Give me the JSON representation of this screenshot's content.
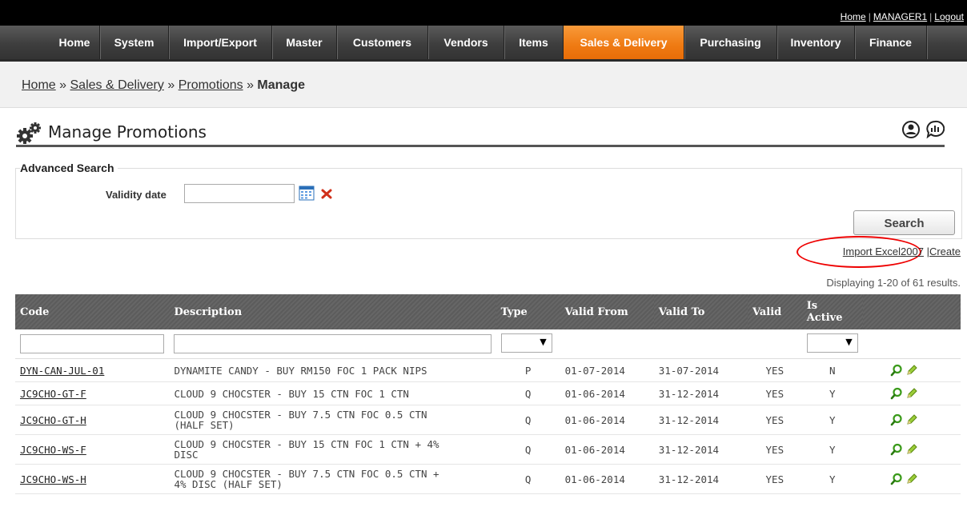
{
  "top_links": {
    "home": "Home",
    "user": "MANAGER1",
    "logout": "Logout"
  },
  "nav": [
    {
      "label": "Home"
    },
    {
      "label": "System"
    },
    {
      "label": "Import/Export"
    },
    {
      "label": "Master"
    },
    {
      "label": "Customers"
    },
    {
      "label": "Vendors"
    },
    {
      "label": "Items"
    },
    {
      "label": "Sales & Delivery",
      "active": true
    },
    {
      "label": "Purchasing"
    },
    {
      "label": "Inventory"
    },
    {
      "label": "Finance"
    }
  ],
  "breadcrumb": {
    "home": "Home",
    "sales": "Sales & Delivery",
    "promotions": "Promotions",
    "current": "Manage",
    "sep": "»"
  },
  "page_title": "Manage Promotions",
  "search": {
    "legend": "Advanced Search",
    "validity_label": "Validity date",
    "validity_value": "",
    "button": "Search"
  },
  "links": {
    "import": "Import Excel2007",
    "sep": "|",
    "create": "Create"
  },
  "summary": "Displaying 1-20 of 61 results.",
  "columns": {
    "code": "Code",
    "description": "Description",
    "type": "Type",
    "valid_from": "Valid From",
    "valid_to": "Valid To",
    "valid": "Valid",
    "is_active_1": "Is",
    "is_active_2": "Active"
  },
  "rows": [
    {
      "code": "DYN-CAN-JUL-01",
      "desc1": "DYNAMITE CANDY - BUY RM150 FOC 1 PACK NIPS",
      "desc2": "",
      "type": "P",
      "from": "01-07-2014",
      "to": "31-07-2014",
      "valid": "YES",
      "active": "N"
    },
    {
      "code": "JC9CHO-GT-F",
      "desc1": "CLOUD 9 CHOCSTER - BUY 15 CTN FOC 1 CTN",
      "desc2": "",
      "type": "Q",
      "from": "01-06-2014",
      "to": "31-12-2014",
      "valid": "YES",
      "active": "Y"
    },
    {
      "code": "JC9CHO-GT-H",
      "desc1": "CLOUD 9 CHOCSTER - BUY 7.5 CTN FOC 0.5 CTN",
      "desc2": "(HALF SET)",
      "type": "Q",
      "from": "01-06-2014",
      "to": "31-12-2014",
      "valid": "YES",
      "active": "Y"
    },
    {
      "code": "JC9CHO-WS-F",
      "desc1": "CLOUD 9 CHOCSTER - BUY 15 CTN FOC 1 CTN + 4%",
      "desc2": "DISC",
      "type": "Q",
      "from": "01-06-2014",
      "to": "31-12-2014",
      "valid": "YES",
      "active": "Y"
    },
    {
      "code": "JC9CHO-WS-H",
      "desc1": "CLOUD 9 CHOCSTER - BUY 7.5 CTN FOC 0.5 CTN +",
      "desc2": "4% DISC (HALF SET)",
      "type": "Q",
      "from": "01-06-2014",
      "to": "31-12-2014",
      "valid": "YES",
      "active": "Y"
    }
  ],
  "colors": {
    "active_tab": "#ef7a12",
    "nav_bg": "#444444",
    "highlight_oval": "#e00000"
  },
  "icons": {
    "title": "gears-icon",
    "help1": "user-help-icon",
    "help2": "chat-stats-icon",
    "calendar": "calendar-icon",
    "clear": "clear-x-icon",
    "view": "magnifier-icon",
    "edit": "pencil-icon"
  }
}
